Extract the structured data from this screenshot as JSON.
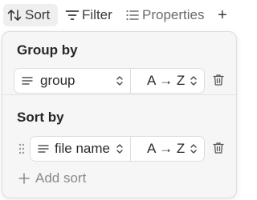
{
  "toolbar": {
    "sort_label": "Sort",
    "filter_label": "Filter",
    "properties_label": "Properties",
    "add_label": "+"
  },
  "group_by": {
    "title": "Group by",
    "field": "group",
    "direction": "A → Z"
  },
  "sort_by": {
    "title": "Sort by",
    "field": "file name",
    "direction": "A → Z",
    "add_label": "Add sort"
  },
  "colors": {
    "panel_bg": "#f6f6f6",
    "active_tab_bg": "#efefef",
    "muted_text": "#8a8a8a"
  }
}
